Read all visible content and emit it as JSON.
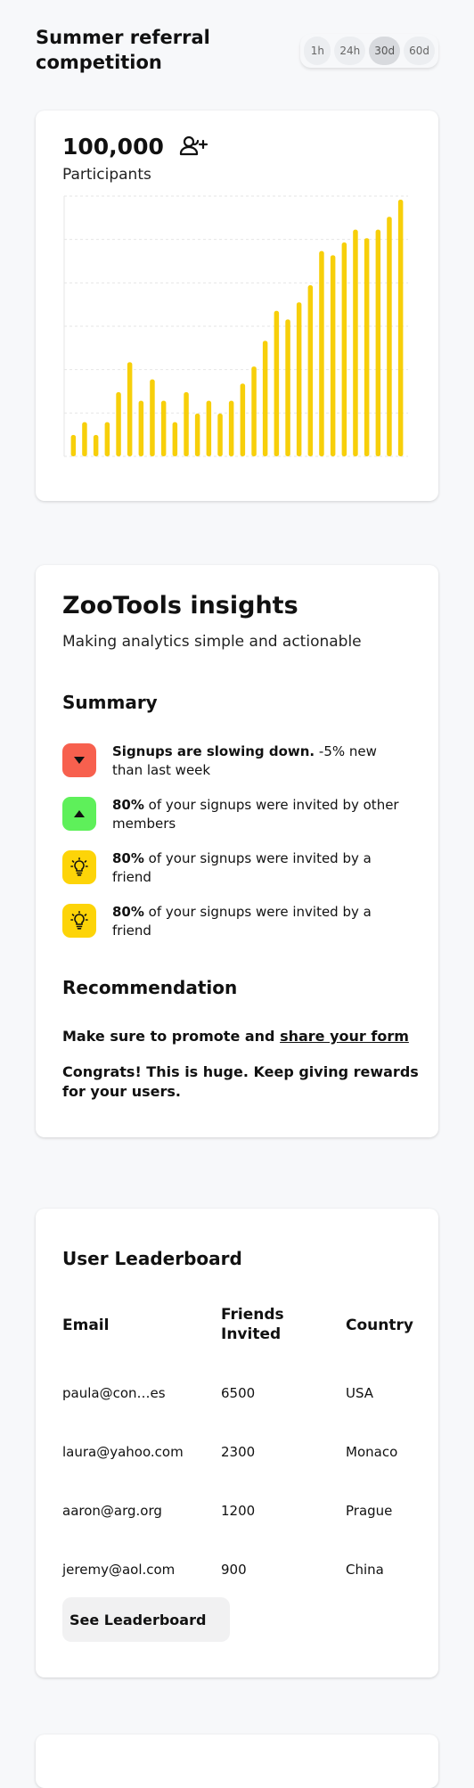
{
  "header": {
    "title": "Summer referral competition",
    "ranges": [
      {
        "label": "1h",
        "active": false
      },
      {
        "label": "24h",
        "active": false
      },
      {
        "label": "30d",
        "active": true
      },
      {
        "label": "60d",
        "active": false
      }
    ]
  },
  "participants": {
    "value": "100,000",
    "label": "Participants",
    "icon": "user-plus-icon"
  },
  "chart_data": {
    "type": "bar",
    "values": [
      5,
      8,
      5,
      8,
      15,
      22,
      13,
      18,
      13,
      8,
      15,
      10,
      13,
      10,
      13,
      17,
      21,
      27,
      34,
      32,
      36,
      40,
      48,
      47,
      50,
      53,
      51,
      53,
      56,
      60
    ],
    "ylim": [
      0,
      60
    ],
    "grid": true,
    "color": "#f7cf0a"
  },
  "insights": {
    "title": "ZooTools insights",
    "subtitle": "Making analytics simple and actionable",
    "summary_title": "Summary",
    "summary": [
      {
        "icon": "arrow-down-icon",
        "color": "#f7604e",
        "bold": "Signups are slowing down.",
        "text": " -5% new than last week"
      },
      {
        "icon": "arrow-up-icon",
        "color": "#5ef05a",
        "bold": "80%",
        "text": " of your signups were invited by other members"
      },
      {
        "icon": "lightbulb-icon",
        "color": "#fdd408",
        "bold": "80%",
        "text": " of your signups were invited by a friend"
      },
      {
        "icon": "lightbulb-icon",
        "color": "#fdd408",
        "bold": "80%",
        "text": " of your signups were invited by a friend"
      }
    ],
    "recommendation_title": "Recommendation",
    "recommendation_prefix": "Make sure to promote and ",
    "recommendation_link": "share your form",
    "congrats": "Congrats! This is huge. Keep giving rewards for your users."
  },
  "leaderboard": {
    "title": "User Leaderboard",
    "columns": [
      "Email",
      "Friends Invited",
      "Country"
    ],
    "rows": [
      [
        "paula@con…es",
        "6500",
        "USA"
      ],
      [
        "laura@yahoo.com",
        "2300",
        "Monaco"
      ],
      [
        "aaron@arg.org",
        "1200",
        "Prague"
      ],
      [
        "jeremy@aol.com",
        "900",
        "China"
      ]
    ],
    "button": "See Leaderboard"
  }
}
